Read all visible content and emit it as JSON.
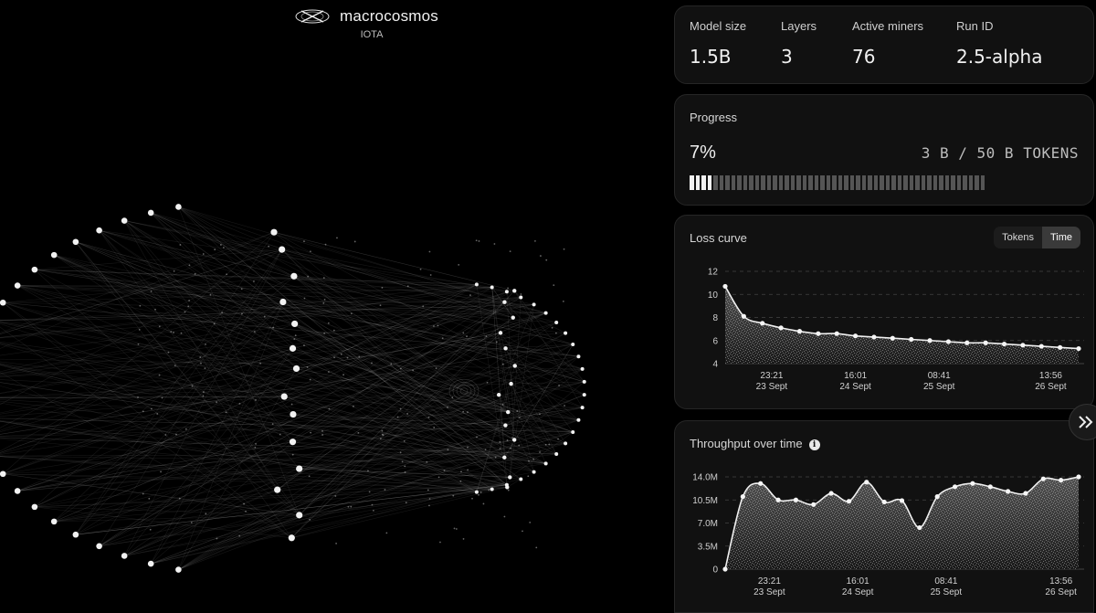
{
  "brand": {
    "name": "macrocosmos",
    "subtitle": "IOTA",
    "icon": "macrocosmos-logo-icon"
  },
  "stats": [
    {
      "label": "Model size",
      "value": "1.5B"
    },
    {
      "label": "Layers",
      "value": "3"
    },
    {
      "label": "Active miners",
      "value": "76"
    },
    {
      "label": "Run ID",
      "value": "2.5-alpha"
    }
  ],
  "progress": {
    "title": "Progress",
    "percent_text": "7%",
    "tokens_text": "3 B / 50 B TOKENS",
    "fraction": 0.07,
    "segments_total": 50,
    "segments_filled": 4
  },
  "loss": {
    "title": "Loss curve",
    "toggle": [
      "Tokens",
      "Time"
    ],
    "toggle_active": "Time"
  },
  "throughput": {
    "title": "Throughput over time",
    "info_icon": "info-icon"
  },
  "expand_icon": "double-chevron-right-icon",
  "colors": {
    "background": "#000000",
    "card": "#111111",
    "accent": "#f2f2f2",
    "muted_segment": "#555555"
  },
  "chart_data": [
    {
      "type": "area",
      "title": "Loss curve",
      "xlabel": "",
      "ylabel": "",
      "ylim": [
        4,
        12
      ],
      "y_ticks": [
        "12",
        "10",
        "8",
        "6",
        "4"
      ],
      "x_ticks": [
        {
          "time": "23:21",
          "date": "23 Sept",
          "index": 2.5
        },
        {
          "time": "16:01",
          "date": "24 Sept",
          "index": 7
        },
        {
          "time": "08:41",
          "date": "25 Sept",
          "index": 11.5
        },
        {
          "time": "13:56",
          "date": "26 Sept",
          "index": 17.5
        }
      ],
      "values": [
        10.7,
        8.1,
        7.5,
        7.1,
        6.8,
        6.6,
        6.6,
        6.4,
        6.3,
        6.2,
        6.1,
        6.0,
        5.9,
        5.8,
        5.8,
        5.7,
        5.6,
        5.5,
        5.4,
        5.3
      ],
      "grid": true,
      "legend": "none"
    },
    {
      "type": "area",
      "title": "Throughput over time",
      "xlabel": "",
      "ylabel": "",
      "ylim": [
        0,
        14000000
      ],
      "y_ticks": [
        "14.0M",
        "10.5M",
        "7.0M",
        "3.5M",
        "0"
      ],
      "x_ticks": [
        {
          "time": "23:21",
          "date": "23 Sept",
          "index": 2.5
        },
        {
          "time": "16:01",
          "date": "24 Sept",
          "index": 7.5
        },
        {
          "time": "08:41",
          "date": "25 Sept",
          "index": 12.5
        },
        {
          "time": "13:56",
          "date": "26 Sept",
          "index": 19
        }
      ],
      "values": [
        0,
        11000000,
        13000000,
        10500000,
        10500000,
        9800000,
        11500000,
        10300000,
        13200000,
        10200000,
        10400000,
        6300000,
        11000000,
        12500000,
        13000000,
        12500000,
        11800000,
        11500000,
        13700000,
        13500000,
        14000000
      ],
      "grid": true,
      "legend": "none"
    }
  ]
}
